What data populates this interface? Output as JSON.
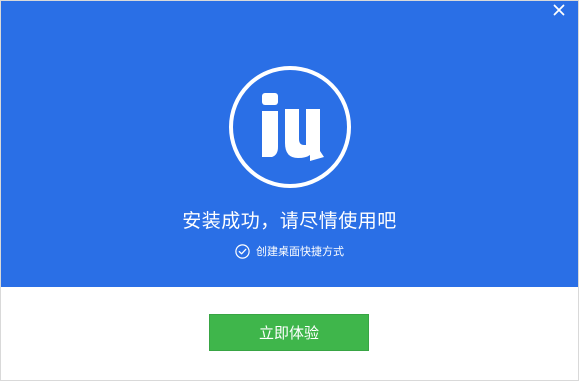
{
  "window": {
    "close_icon": "close-icon",
    "hero_color": "#2a6fe6",
    "button_color": "#3fb64b"
  },
  "hero": {
    "logo_icon": "iu-logo-icon",
    "headline": "安装成功，请尽情使用吧",
    "shortcut_checkbox": {
      "label": "创建桌面快捷方式",
      "checked": true
    }
  },
  "footer": {
    "primary_button": "立即体验"
  }
}
